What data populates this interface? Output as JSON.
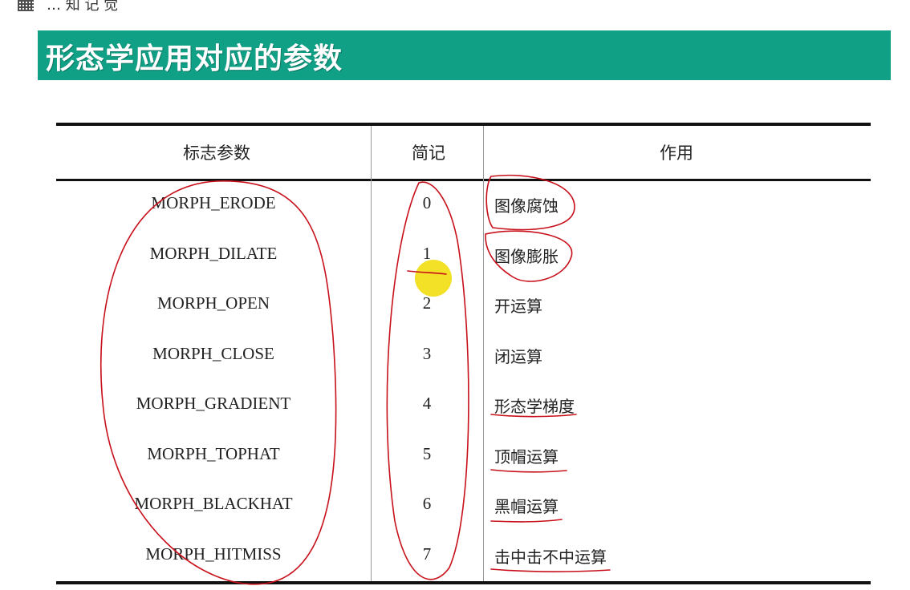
{
  "slide": {
    "title": "形态学应用对应的参数",
    "corner_fragment": "… 知 记 觉"
  },
  "table": {
    "headers": {
      "param": "标志参数",
      "code": "简记",
      "use": "作用"
    },
    "rows": [
      {
        "param": "MORPH_ERODE",
        "code": "0",
        "use": "图像腐蚀"
      },
      {
        "param": "MORPH_DILATE",
        "code": "1",
        "use": "图像膨胀"
      },
      {
        "param": "MORPH_OPEN",
        "code": "2",
        "use": "开运算"
      },
      {
        "param": "MORPH_CLOSE",
        "code": "3",
        "use": "闭运算"
      },
      {
        "param": "MORPH_GRADIENT",
        "code": "4",
        "use": "形态学梯度"
      },
      {
        "param": "MORPH_TOPHAT",
        "code": "5",
        "use": "顶帽运算"
      },
      {
        "param": "MORPH_BLACKHAT",
        "code": "6",
        "use": "黑帽运算"
      },
      {
        "param": "MORPH_HITMISS",
        "code": "7",
        "use": "击中击不中运算"
      }
    ]
  },
  "colors": {
    "banner": "#10a085",
    "annotation": "#c8101a",
    "pointer": "#f0dc00"
  }
}
